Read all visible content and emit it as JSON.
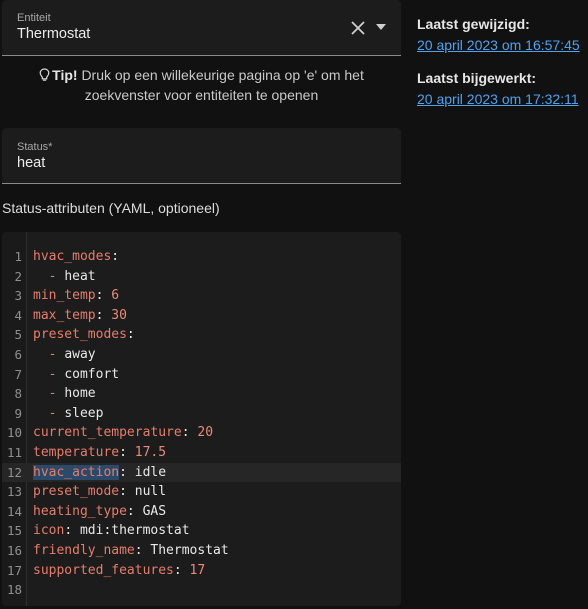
{
  "entity_field": {
    "label": "Entiteit",
    "value": "Thermostat",
    "clear_icon": "close-icon",
    "dropdown_icon": "chevron-down-icon"
  },
  "tip": {
    "icon": "lightbulb-icon",
    "bold": "Tip!",
    "text": "Druk op een willekeurige pagina op 'e' om het zoekvenster voor entiteiten te openen"
  },
  "status_field": {
    "label": "Status*",
    "value": "heat"
  },
  "attributes": {
    "label": "Status-attributen (YAML, optioneel)",
    "active_line": 12,
    "lines": [
      {
        "n": "1",
        "key": "hvac_modes",
        "sep": ":",
        "value": ""
      },
      {
        "n": "2",
        "dash": "  - ",
        "value": "heat"
      },
      {
        "n": "3",
        "key": "min_temp",
        "sep": ": ",
        "num": "6"
      },
      {
        "n": "4",
        "key": "max_temp",
        "sep": ": ",
        "num": "30"
      },
      {
        "n": "5",
        "key": "preset_modes",
        "sep": ":",
        "value": ""
      },
      {
        "n": "6",
        "dash": "  - ",
        "value": "away"
      },
      {
        "n": "7",
        "dash": "  - ",
        "value": "comfort"
      },
      {
        "n": "8",
        "dash": "  - ",
        "value": "home"
      },
      {
        "n": "9",
        "dash": "  - ",
        "value": "sleep"
      },
      {
        "n": "10",
        "key": "current_temperature",
        "sep": ": ",
        "num": "20"
      },
      {
        "n": "11",
        "key": "temperature",
        "sep": ": ",
        "num": "17.5"
      },
      {
        "n": "12",
        "key": "hvac_action",
        "sep": ": ",
        "value": "idle"
      },
      {
        "n": "13",
        "key": "preset_mode",
        "sep": ": ",
        "value": "null"
      },
      {
        "n": "14",
        "key": "heating_type",
        "sep": ": ",
        "value": "GAS"
      },
      {
        "n": "15",
        "key": "icon",
        "sep": ": ",
        "value": "mdi:thermostat"
      },
      {
        "n": "16",
        "key": "friendly_name",
        "sep": ": ",
        "value": "Thermostat"
      },
      {
        "n": "17",
        "key": "supported_features",
        "sep": ": ",
        "num": "17"
      },
      {
        "n": "18",
        "value": ""
      }
    ]
  },
  "meta": {
    "last_changed_label": "Laatst gewijzigd:",
    "last_changed_value": "20 april 2023 om 16:57:45",
    "last_updated_label": "Laatst bijgewerkt:",
    "last_updated_value": "20 april 2023 om 17:32:11"
  },
  "colors": {
    "background": "#111111",
    "panel": "#1c1c1c",
    "yaml_key": "#e67d6a",
    "link": "#4aa3f0"
  }
}
